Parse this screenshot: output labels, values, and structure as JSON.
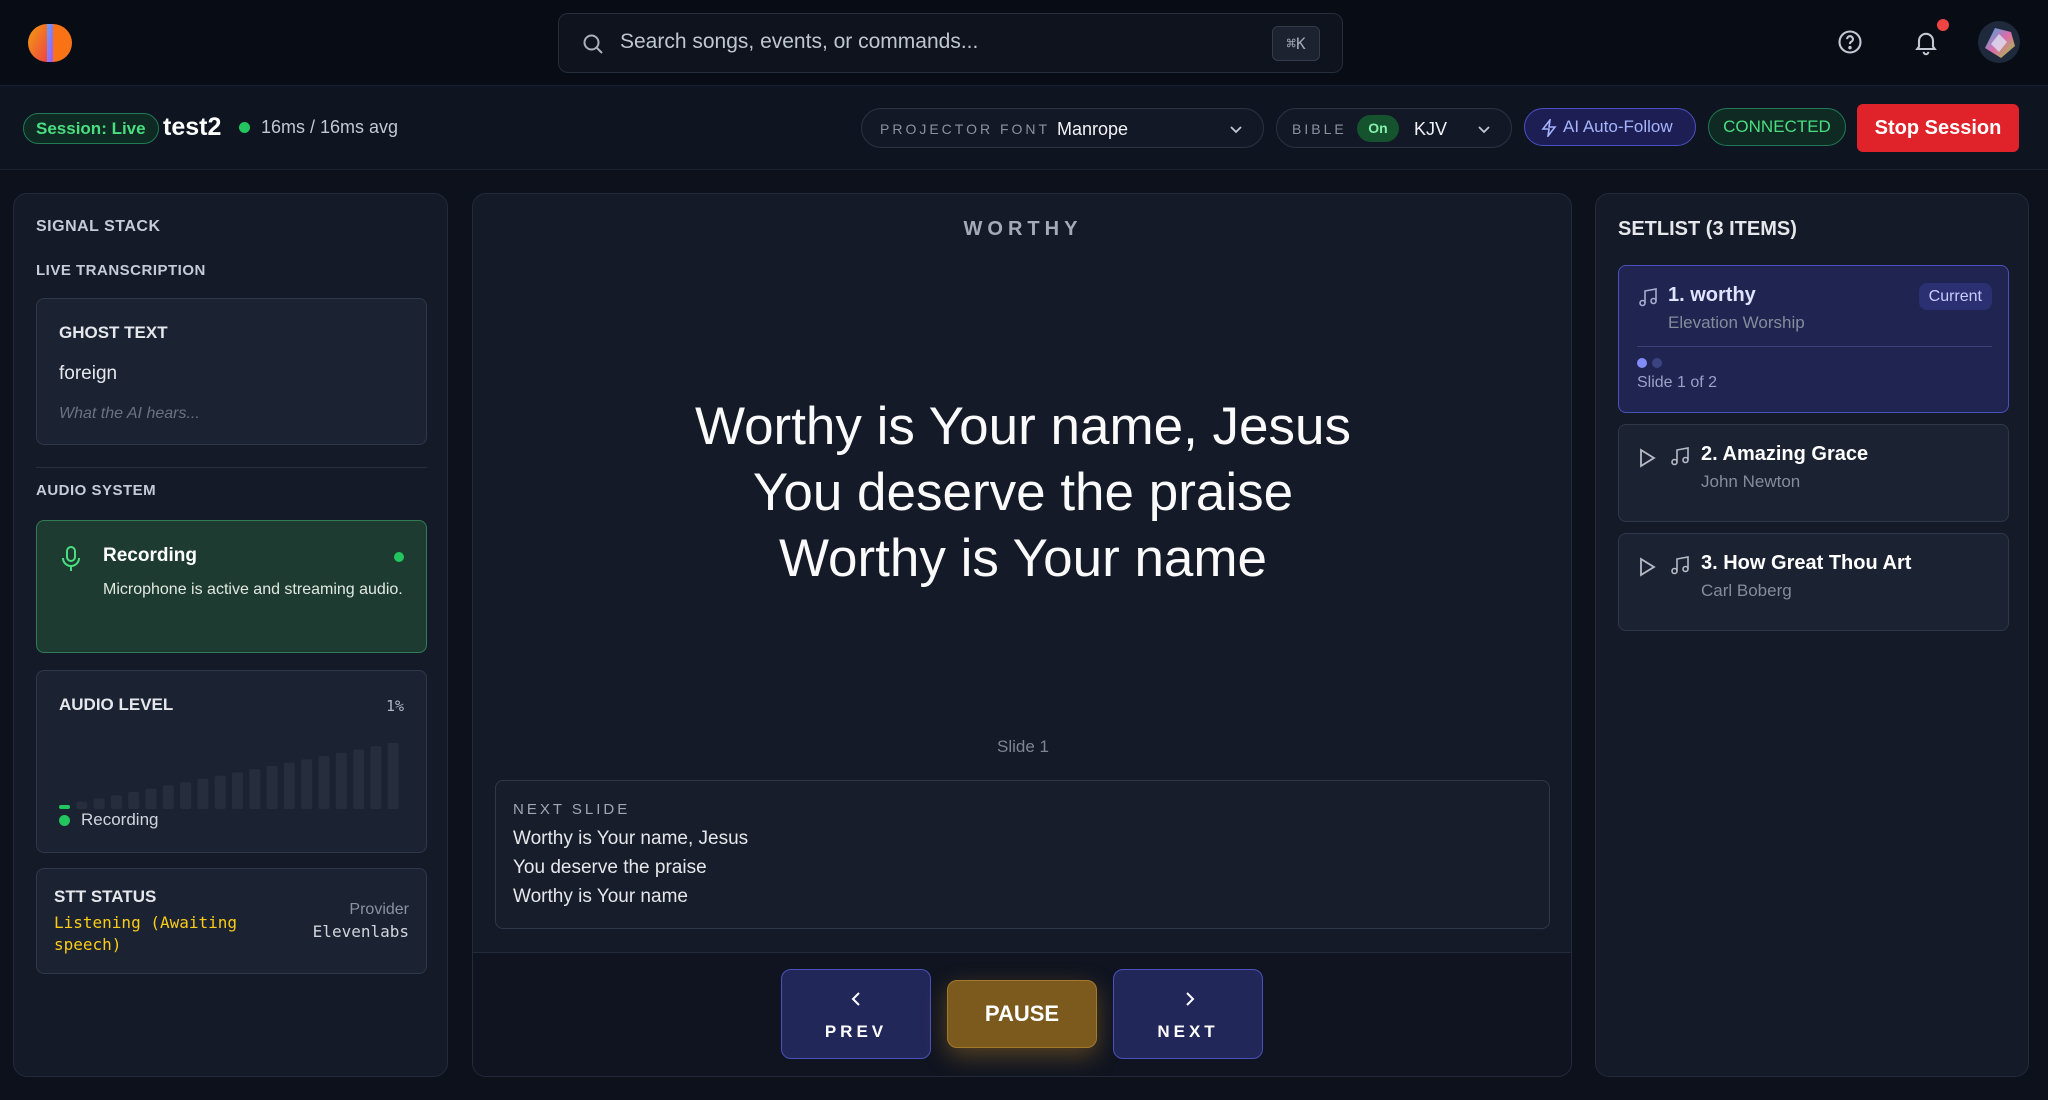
{
  "header": {
    "search_placeholder": "Search songs, events, or commands...",
    "search_shortcut": "⌘K"
  },
  "session": {
    "status_badge": "Session: Live",
    "name": "test2",
    "latency": "16ms / 16ms avg",
    "projector_font_label": "PROJECTOR FONT",
    "projector_font_value": "Manrope",
    "bible_label": "BIBLE",
    "bible_toggle": "On",
    "bible_version": "KJV",
    "ai_follow_label": "AI Auto-Follow",
    "connection_status": "CONNECTED",
    "stop_label": "Stop Session"
  },
  "signal_stack": {
    "title": "SIGNAL STACK",
    "live_transcription_title": "LIVE TRANSCRIPTION",
    "ghost_text": {
      "title": "GHOST TEXT",
      "value": "foreign",
      "hint": "What the AI hears..."
    },
    "audio_system_title": "AUDIO SYSTEM",
    "recording": {
      "title": "Recording",
      "description": "Microphone is active and streaming audio."
    },
    "audio_level": {
      "title": "AUDIO LEVEL",
      "percent": "1%",
      "level_fraction": 0.01,
      "status": "Recording"
    },
    "stt": {
      "title": "STT STATUS",
      "status": "Listening (Awaiting speech)",
      "provider_label": "Provider",
      "provider": "Elevenlabs"
    }
  },
  "projector": {
    "song_title": "WORTHY",
    "lines": [
      "Worthy is Your name, Jesus",
      "You deserve the praise",
      "Worthy is Your name"
    ],
    "slide_label": "Slide 1",
    "next_slide_label": "NEXT SLIDE",
    "next_lines": [
      "Worthy is Your name, Jesus",
      "You deserve the praise",
      "Worthy is Your name"
    ],
    "prev_label": "PREV",
    "pause_label": "PAUSE",
    "next_label": "NEXT"
  },
  "setlist": {
    "title": "SETLIST (3 ITEMS)",
    "items": [
      {
        "name": "1. worthy",
        "artist": "Elevation Worship",
        "badge": "Current",
        "progress": "Slide 1 of 2"
      },
      {
        "name": "2. Amazing Grace",
        "artist": "John Newton"
      },
      {
        "name": "3. How Great Thou Art",
        "artist": "Carl Boberg"
      }
    ]
  },
  "colors": {
    "accent": "#4a51b8",
    "live_green": "#22c55e",
    "stop_red": "#e0222b",
    "warning_yellow": "#facc15"
  },
  "icons": [
    "app-logo",
    "search-icon",
    "help-icon",
    "bell-icon",
    "avatar",
    "chevron-down-icon",
    "bolt-icon",
    "microphone-icon",
    "music-note-icon",
    "play-icon",
    "chevron-left-icon",
    "chevron-right-icon"
  ]
}
